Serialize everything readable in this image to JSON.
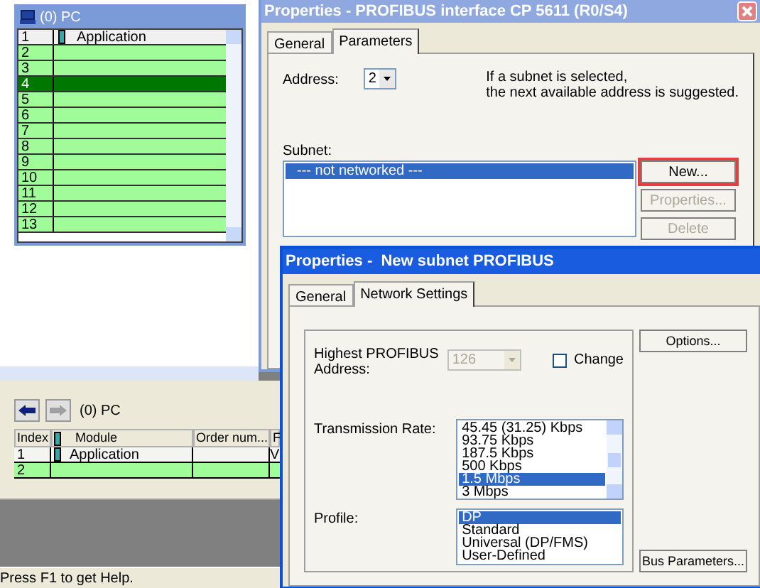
{
  "pc_window": {
    "title": "(0) PC",
    "rows": [
      {
        "slot": "1",
        "module": "Application",
        "selected": false
      },
      {
        "slot": "2",
        "selected": false
      },
      {
        "slot": "3",
        "selected": false
      },
      {
        "slot": "4",
        "selected": true
      },
      {
        "slot": "5",
        "selected": false
      },
      {
        "slot": "6",
        "selected": false
      },
      {
        "slot": "7",
        "selected": false
      },
      {
        "slot": "8",
        "selected": false
      },
      {
        "slot": "9",
        "selected": false
      },
      {
        "slot": "10",
        "selected": false
      },
      {
        "slot": "11",
        "selected": false
      },
      {
        "slot": "12",
        "selected": false
      },
      {
        "slot": "13",
        "selected": false
      }
    ]
  },
  "module_panel": {
    "title": "(0) PC",
    "columns": [
      "Index",
      "Module",
      "Order num...",
      "F"
    ],
    "rows": [
      {
        "index": "1",
        "module": "Application",
        "column_4": "V"
      },
      {
        "index": "2"
      }
    ]
  },
  "status_bar": "Press F1 to get Help.",
  "interface_dialog": {
    "title": "Properties - PROFIBUS interface  CP 5611 (R0/S4)",
    "tabs": [
      {
        "label": "General",
        "selected": false
      },
      {
        "label": "Parameters",
        "selected": true
      }
    ],
    "address_label": "Address:",
    "address_value": "2",
    "hint": [
      "If a subnet is selected,",
      "the next available address is suggested."
    ],
    "subnet_label": "Subnet:",
    "subnets": [
      {
        "label": "--- not networked ---",
        "selected": true
      }
    ],
    "buttons": [
      {
        "label": "New...",
        "disabled": false,
        "focused": true
      },
      {
        "label": "Properties...",
        "disabled": true,
        "focused": false
      },
      {
        "label": "Delete",
        "disabled": true,
        "focused": false
      }
    ]
  },
  "subnet_dialog": {
    "title": "Properties -  New subnet PROFIBUS",
    "tabs": [
      {
        "label": "General",
        "selected": false
      },
      {
        "label": "Network Settings",
        "selected": true
      }
    ],
    "highest_address_label": "Highest PROFIBUS Address:",
    "highest_address_value": "126",
    "highest_address_disabled": true,
    "change": {
      "label": "Change",
      "checked": false
    },
    "transmission_rate_label": "Transmission Rate:",
    "transmission_rates": [
      {
        "label": "45.45 (31.25) Kbps",
        "selected": false
      },
      {
        "label": "93.75 Kbps",
        "selected": false
      },
      {
        "label": "187.5 Kbps",
        "selected": false
      },
      {
        "label": "500 Kbps",
        "selected": false
      },
      {
        "label": "1.5 Mbps",
        "selected": true
      },
      {
        "label": "3 Mbps",
        "selected": false
      }
    ],
    "profile_label": "Profile:",
    "profiles": [
      {
        "label": "DP",
        "selected": true
      },
      {
        "label": "Standard",
        "selected": false
      },
      {
        "label": "Universal (DP/FMS)",
        "selected": false
      },
      {
        "label": "User-Defined",
        "selected": false
      }
    ],
    "buttons": [
      {
        "label": "Options..."
      },
      {
        "label": "Bus Parameters..."
      }
    ]
  }
}
